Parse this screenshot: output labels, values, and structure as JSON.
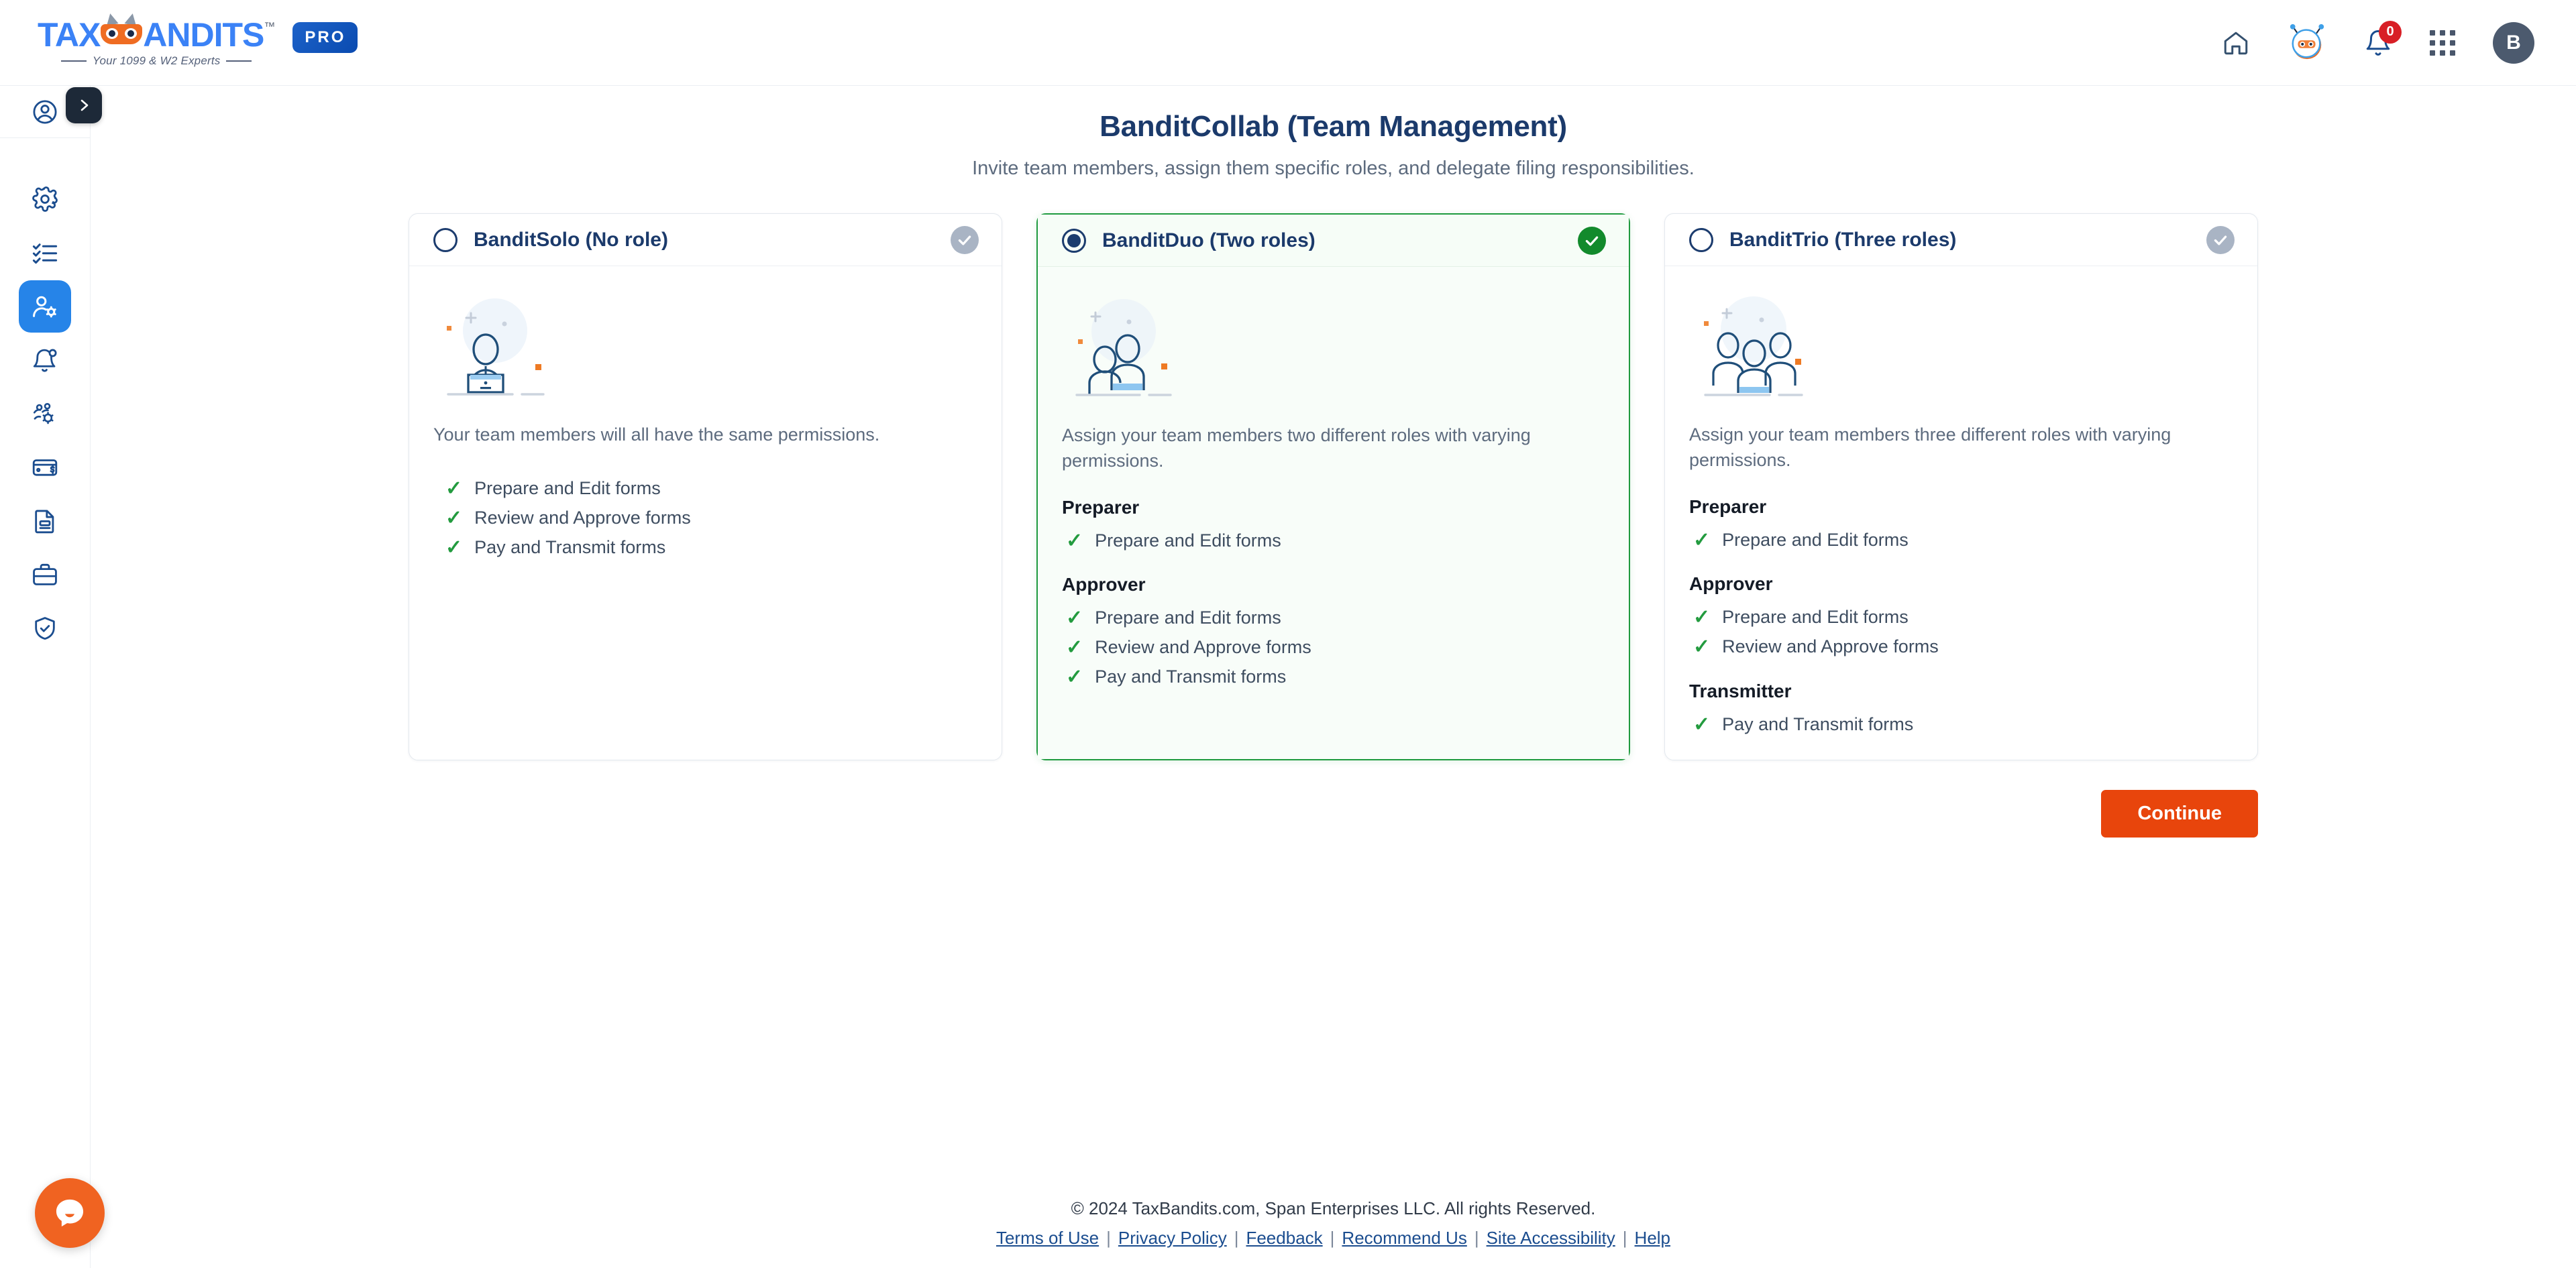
{
  "header": {
    "logo_text": "TAXBANDITS",
    "logo_tm": "™",
    "logo_tagline": "Your 1099 & W2 Experts",
    "pro_badge": "PRO",
    "home_icon": "home-icon",
    "bot_icon": "bandit-bot-icon",
    "bell_icon": "bell-icon",
    "notification_count": "0",
    "apps_icon": "apps-grid-icon",
    "avatar_initial": "B"
  },
  "sidebar": {
    "toggle_icon": "chevron-right-icon",
    "items": [
      {
        "name": "sidebar-item-account",
        "icon": "user-circle-icon",
        "active": false
      },
      {
        "name": "sidebar-item-settings",
        "icon": "gear-icon",
        "active": false
      },
      {
        "name": "sidebar-item-tasks",
        "icon": "list-check-icon",
        "active": false
      },
      {
        "name": "sidebar-item-team-management",
        "icon": "user-gear-icon",
        "active": true
      },
      {
        "name": "sidebar-item-notifications",
        "icon": "bell-dot-icon",
        "active": false
      },
      {
        "name": "sidebar-item-integrations",
        "icon": "settings-multi-icon",
        "active": false
      },
      {
        "name": "sidebar-item-billing",
        "icon": "card-dollar-icon",
        "active": false
      },
      {
        "name": "sidebar-item-documents",
        "icon": "document-icon",
        "active": false
      },
      {
        "name": "sidebar-item-business",
        "icon": "briefcase-icon",
        "active": false
      },
      {
        "name": "sidebar-item-security",
        "icon": "shield-check-icon",
        "active": false
      }
    ]
  },
  "main": {
    "title": "BanditCollab (Team Management)",
    "subtitle": "Invite team members, assign them specific roles, and delegate filing responsibilities.",
    "continue_label": "Continue",
    "cards": [
      {
        "id": "banditsolo",
        "title": "BanditSolo (No role)",
        "selected": false,
        "illustration": "one-person-illustration",
        "description": "Your team members will all have the same permissions.",
        "permissions": [
          "Prepare and Edit forms",
          "Review and Approve forms",
          "Pay and Transmit forms"
        ],
        "roles": []
      },
      {
        "id": "banditduo",
        "title": "BanditDuo (Two roles)",
        "selected": true,
        "illustration": "two-people-illustration",
        "description": "Assign your team members two different roles with varying permissions.",
        "permissions": [],
        "roles": [
          {
            "name": "Preparer",
            "permissions": [
              "Prepare and Edit forms"
            ]
          },
          {
            "name": "Approver",
            "permissions": [
              "Prepare and Edit forms",
              "Review and Approve forms",
              "Pay and Transmit forms"
            ]
          }
        ]
      },
      {
        "id": "bandittrio",
        "title": "BanditTrio (Three roles)",
        "selected": false,
        "illustration": "three-people-illustration",
        "description": "Assign your team members three different roles with varying permissions.",
        "permissions": [],
        "roles": [
          {
            "name": "Preparer",
            "permissions": [
              "Prepare and Edit forms"
            ]
          },
          {
            "name": "Approver",
            "permissions": [
              "Prepare and Edit forms",
              "Review and Approve forms"
            ]
          },
          {
            "name": "Transmitter",
            "permissions": [
              "Pay and Transmit forms"
            ]
          }
        ]
      }
    ]
  },
  "footer": {
    "copyright": "© 2024 TaxBandits.com, Span Enterprises LLC. All rights Reserved.",
    "links": [
      "Terms of Use",
      "Privacy Policy",
      "Feedback",
      "Recommend Us",
      "Site Accessibility",
      "Help"
    ],
    "separator": "|"
  },
  "chat": {
    "icon": "chat-bubble-icon"
  },
  "colors": {
    "accent_orange": "#e8450c",
    "brand_blue": "#3b82f6",
    "title_navy": "#1b3a6b",
    "success_green": "#128a2c",
    "active_blue": "#2684e8"
  }
}
